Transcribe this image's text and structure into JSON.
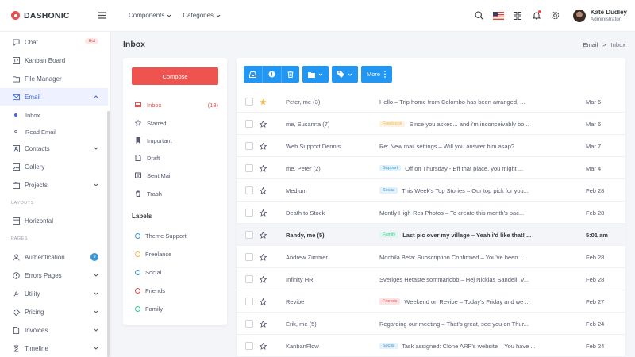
{
  "brand": {
    "name": "DASHONIC"
  },
  "topnav": [
    {
      "label": "Components"
    },
    {
      "label": "Categories"
    }
  ],
  "user": {
    "name": "Kate Dudley",
    "role": "Administrator"
  },
  "sidebar": {
    "items": [
      {
        "label": "Chat",
        "badge": "Hot"
      },
      {
        "label": "Kanban Board"
      },
      {
        "label": "File Manager"
      },
      {
        "label": "Email"
      },
      {
        "label": "Contacts"
      },
      {
        "label": "Gallery"
      },
      {
        "label": "Projects"
      },
      {
        "label": "Horizontal"
      },
      {
        "label": "Authentication",
        "badge": "9"
      },
      {
        "label": "Errors Pages"
      },
      {
        "label": "Utility"
      },
      {
        "label": "Pricing"
      },
      {
        "label": "Invoices"
      },
      {
        "label": "Timeline"
      }
    ],
    "email_sub": [
      {
        "label": "Inbox"
      },
      {
        "label": "Read Email"
      }
    ],
    "headings": {
      "layouts": "LAYOUTS",
      "pages": "PAGES"
    }
  },
  "page": {
    "title": "Inbox"
  },
  "breadcrumb": {
    "parent": "Email",
    "separator": ">",
    "current": "Inbox"
  },
  "mail_nav": {
    "compose_label": "Compose",
    "folders": [
      {
        "label": "Inbox",
        "count": "(18)"
      },
      {
        "label": "Starred"
      },
      {
        "label": "Important"
      },
      {
        "label": "Draft"
      },
      {
        "label": "Sent Mail"
      },
      {
        "label": "Trash"
      }
    ],
    "labels_title": "Labels",
    "labels": [
      {
        "label": "Theme Support",
        "color": "#3b97d3"
      },
      {
        "label": "Freelance",
        "color": "#f7b84b"
      },
      {
        "label": "Social",
        "color": "#3b97d3"
      },
      {
        "label": "Friends",
        "color": "#e35050"
      },
      {
        "label": "Family",
        "color": "#34c38f"
      }
    ]
  },
  "toolbar": {
    "more_label": "More"
  },
  "emails": [
    {
      "from": "Peter, me (3)",
      "tag": "",
      "subject": "Hello – Trip home from Colombo has been arranged, ...",
      "date": "Mar 6",
      "starred": true,
      "unread": false
    },
    {
      "from": "me, Susanna (7)",
      "tag": "Freelance",
      "subject": "Since you asked... and i'm inconceivably bo...",
      "date": "Mar 6",
      "starred": false,
      "unread": false
    },
    {
      "from": "Web Support Dennis",
      "tag": "",
      "subject": "Re: New mail settings – Will you answer him asap?",
      "date": "Mar 7",
      "starred": false,
      "unread": false
    },
    {
      "from": "me, Peter (2)",
      "tag": "Support",
      "subject": "Off on Thursday - Eff that place, you might ...",
      "date": "Mar 4",
      "starred": false,
      "unread": false
    },
    {
      "from": "Medium",
      "tag": "Social",
      "subject": "This Week's Top Stories – Our top pick for you...",
      "date": "Feb 28",
      "starred": false,
      "unread": false
    },
    {
      "from": "Death to Stock",
      "tag": "",
      "subject": "Montly High-Res Photos – To create this month's pac...",
      "date": "Feb 28",
      "starred": false,
      "unread": false
    },
    {
      "from": "Randy, me (5)",
      "tag": "Family",
      "subject": "Last pic over my village – Yeah i'd like that! ...",
      "date": "5:01 am",
      "starred": false,
      "unread": true
    },
    {
      "from": "Andrew Zimmer",
      "tag": "",
      "subject": "Mochila Beta: Subscription Confirmed – You've been ...",
      "date": "Feb 28",
      "starred": false,
      "unread": false
    },
    {
      "from": "Infinity HR",
      "tag": "",
      "subject": "Sveriges Hetaste sommarjobb – Hej Nicklas Sandell! V...",
      "date": "Feb 28",
      "starred": false,
      "unread": false
    },
    {
      "from": "Revibe",
      "tag": "Friends",
      "subject": "Weekend on Revibe – Today's Friday and we ...",
      "date": "Feb 27",
      "starred": false,
      "unread": false
    },
    {
      "from": "Erik, me (5)",
      "tag": "",
      "subject": "Regarding our meeting – That's great, see you on Thur...",
      "date": "Feb 24",
      "starred": false,
      "unread": false
    },
    {
      "from": "KanbanFlow",
      "tag": "Social",
      "subject": "Task assigned: Clone ARP's website – You have ...",
      "date": "Feb 24",
      "starred": false,
      "unread": false
    }
  ],
  "tag_colors": {
    "Freelance": {
      "fg": "#f1b44c",
      "bg": "#fdf3e0"
    },
    "Support": {
      "fg": "#3b97d3",
      "bg": "#e3f1fa"
    },
    "Social": {
      "fg": "#3b97d3",
      "bg": "#e3f1fa"
    },
    "Family": {
      "fg": "#34c38f",
      "bg": "#e1f6ee"
    },
    "Friends": {
      "fg": "#e35050",
      "bg": "#fce4e4"
    }
  },
  "colors": {
    "accent": "#3f6ad8",
    "primary_button": "#2196f3",
    "compose": "#ef5350",
    "star": "#f7b84b"
  }
}
